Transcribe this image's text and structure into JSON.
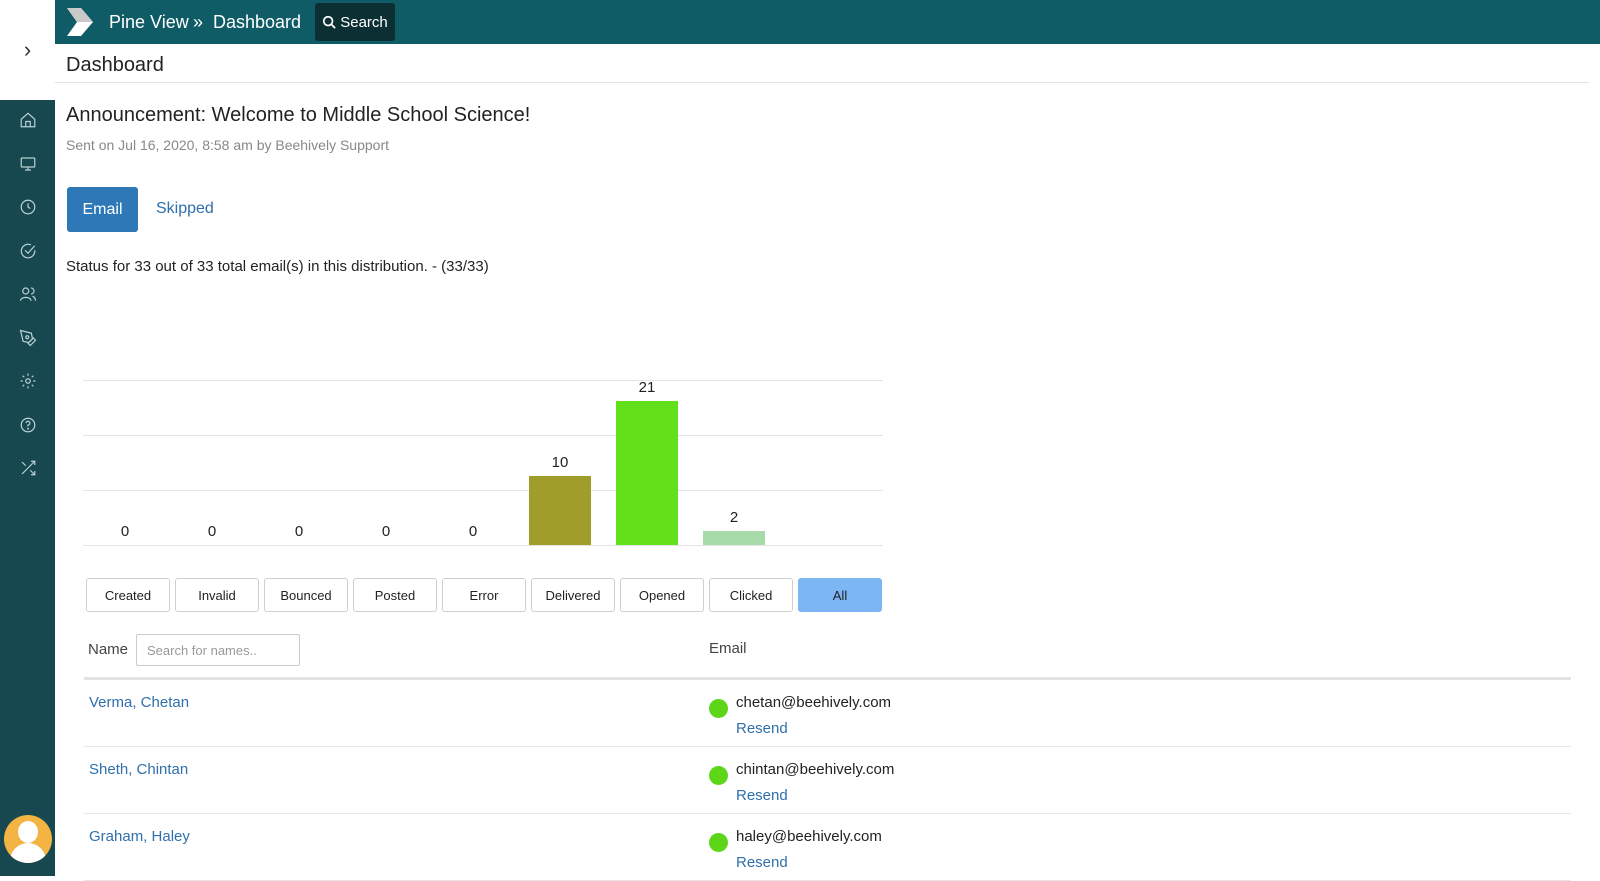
{
  "breadcrumb": {
    "home": "Pine View",
    "separator": "»",
    "current": "Dashboard"
  },
  "search_button": {
    "label": "Search",
    "icon": "search-icon"
  },
  "page_title": "Dashboard",
  "announcement": {
    "title": "Announcement: Welcome to Middle School Science!",
    "meta": "Sent on Jul 16, 2020, 8:58 am by Beehively Support"
  },
  "tabs": {
    "email": "Email",
    "skipped": "Skipped"
  },
  "status_text": "Status for 33 out of 33 total email(s) in this distribution. - (33/33)",
  "sidebar": {
    "toggle_icon": "chevron-right-icon",
    "icons": [
      "home-icon",
      "monitor-icon",
      "clock-icon",
      "check-circle-icon",
      "users-icon",
      "pen-tool-icon",
      "settings-icon",
      "help-icon",
      "shuffle-icon"
    ]
  },
  "chart_data": {
    "type": "bar",
    "categories": [
      "Created",
      "Invalid",
      "Bounced",
      "Posted",
      "Error",
      "Delivered",
      "Opened",
      "Clicked"
    ],
    "values": [
      0,
      0,
      0,
      0,
      0,
      10,
      21,
      2
    ],
    "colors": [
      "#a19d2b",
      "#a19d2b",
      "#a19d2b",
      "#a19d2b",
      "#a19d2b",
      "#a19d2b",
      "#62e01a",
      "#a8dbaa"
    ],
    "ylim": [
      0,
      24
    ],
    "grid": true
  },
  "filters": [
    "Created",
    "Invalid",
    "Bounced",
    "Posted",
    "Error",
    "Delivered",
    "Opened",
    "Clicked",
    "All"
  ],
  "active_filter": "All",
  "table": {
    "name_header": "Name",
    "search_placeholder": "Search for names..",
    "email_header": "Email",
    "rows": [
      {
        "name": "Verma, Chetan",
        "email": "chetan@beehively.com",
        "action": "Resend",
        "status_color": "#5dd61a"
      },
      {
        "name": "Sheth, Chintan",
        "email": "chintan@beehively.com",
        "action": "Resend",
        "status_color": "#5dd61a"
      },
      {
        "name": "Graham, Haley",
        "email": "haley@beehively.com",
        "action": "Resend",
        "status_color": "#5dd61a"
      }
    ]
  },
  "colors": {
    "topbar": "#0f5c66",
    "sidebar": "#17484f",
    "primary": "#2f78b7",
    "link": "#2f6fab"
  }
}
